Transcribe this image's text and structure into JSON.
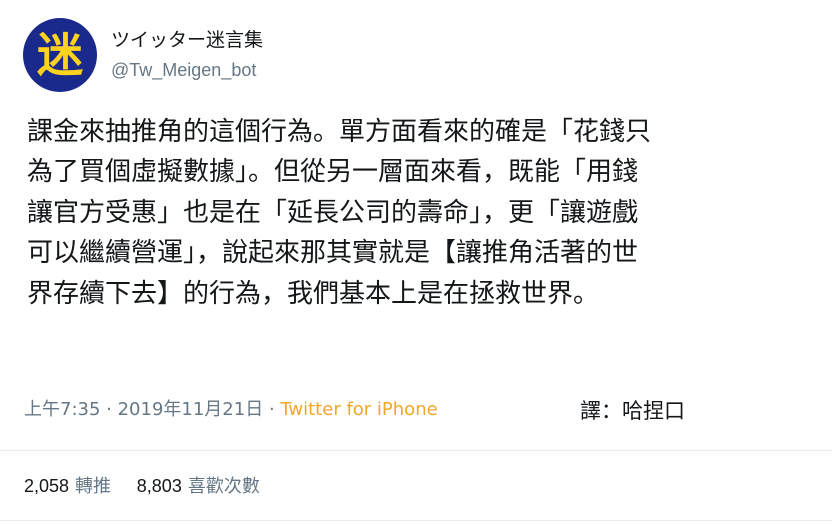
{
  "author": {
    "avatar_text": "迷",
    "display_name": "ツイッター迷言集",
    "handle": "@Tw_Meigen_bot"
  },
  "tweet": {
    "lines": [
      "課金來抽推角的這個行為。單方面看來的確是「花錢只",
      "為了買個虛擬數據」。但從另一層面來看，既能「用錢",
      "讓官方受惠」也是在「延長公司的壽命」，更「讓遊戲",
      "可以繼續營運」，說起來那其實就是【讓推角活著的世",
      "界存續下去】的行為，我們基本上是在拯救世界。"
    ],
    "time": "上午7:35",
    "separator": " · ",
    "date": "2019年11月21日",
    "source": "Twitter for iPhone",
    "credit": "譯：哈捏口"
  },
  "stats": {
    "retweets_count": "2,058",
    "retweets_label": "轉推",
    "likes_count": "8,803",
    "likes_label": "喜歡次數"
  },
  "colors": {
    "avatar_bg": "#1a2a8c",
    "avatar_glyph": "#ffd21e",
    "source_link": "#f1a72a",
    "muted": "#657786",
    "text": "#14171a"
  }
}
